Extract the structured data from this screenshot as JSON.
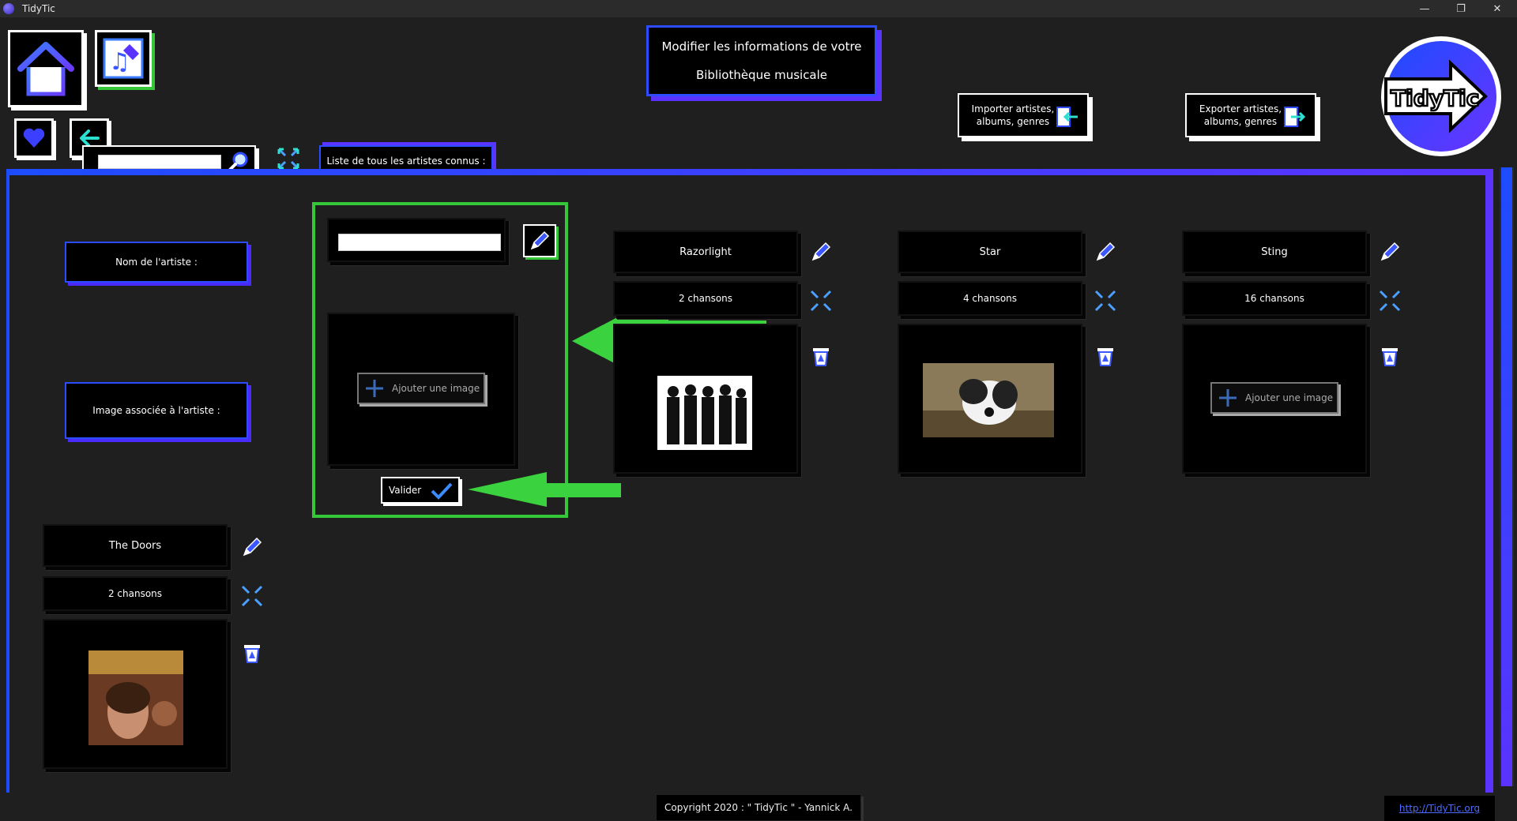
{
  "window": {
    "title": "TidyTic",
    "controls": [
      "—",
      "❐",
      "✕"
    ]
  },
  "header": {
    "title_line1": "Modifier les informations de votre",
    "title_line2": "Bibliothèque musicale",
    "import_label": "Importer artistes, albums, genres",
    "export_label": "Exporter artistes, albums, genres",
    "logo_text": "TidyTic"
  },
  "search": {
    "value": ""
  },
  "list_tab": {
    "label": "Liste de tous les artistes connus :"
  },
  "form": {
    "name_label": "Nom de l'artiste :",
    "image_label": "Image associée à l'artiste :",
    "name_value": "",
    "add_image_label": "Ajouter une image",
    "validate_label": "Valider"
  },
  "artists": [
    {
      "name": "Razorlight",
      "songs": "2 chansons",
      "image": "band-photo"
    },
    {
      "name": "Star",
      "songs": "4 chansons",
      "image": "dog-photo"
    },
    {
      "name": "Sting",
      "songs": "16 chansons",
      "image": "none",
      "add_image_label": "Ajouter une image"
    },
    {
      "name": "The Doors",
      "songs": "2 chansons",
      "image": "doors-album"
    }
  ],
  "footer": {
    "copyright": "Copyright 2020 : \" TidyTic \" - Yannick A.",
    "link": "http://TidyTic.org"
  },
  "colors": {
    "accent_blue": "#1d4cff",
    "accent_purple": "#5a33ff",
    "highlight_green": "#35c63a",
    "background": "#1f1f1f"
  },
  "icons": [
    "home-icon",
    "music-edit-icon",
    "heart-icon",
    "back-arrow-icon",
    "search-icon",
    "expand-icon",
    "pencil-icon",
    "trash-icon",
    "import-icon",
    "export-icon",
    "check-icon",
    "plus-icon"
  ]
}
